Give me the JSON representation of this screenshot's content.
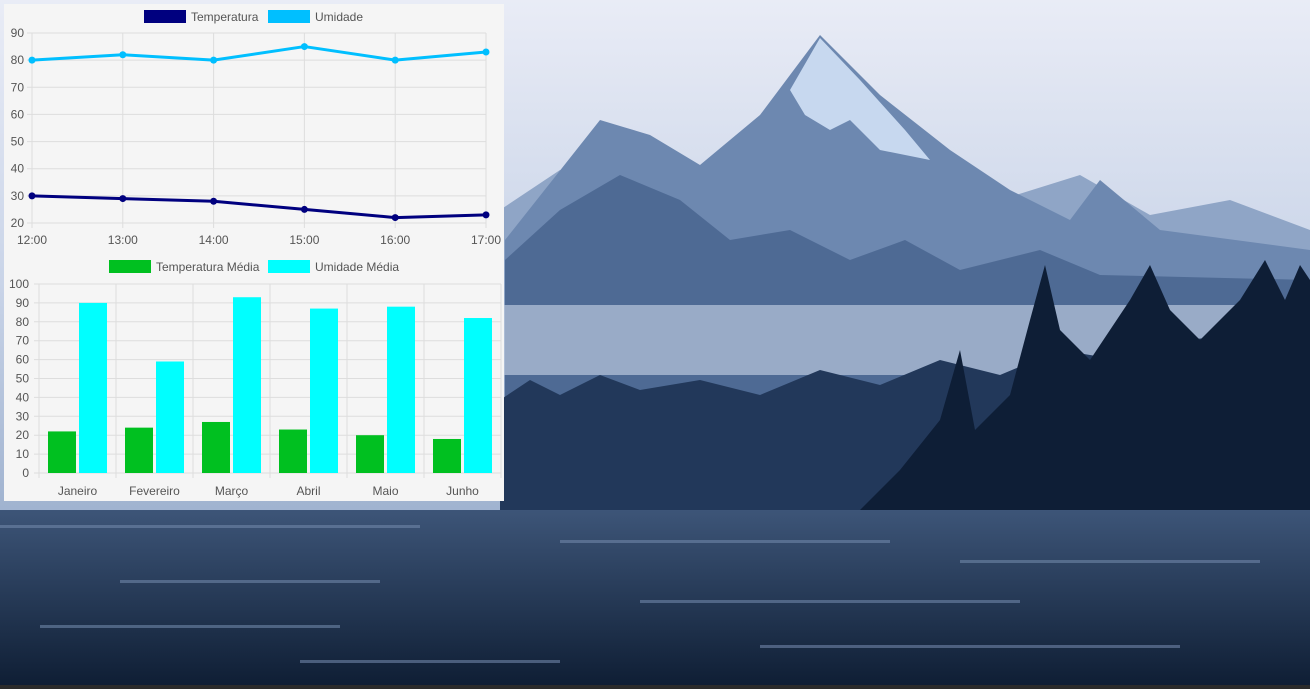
{
  "colors": {
    "temperatura": "#00007f",
    "umidade": "#00bfff",
    "temperatura_media": "#00c020",
    "umidade_media": "#00ffff",
    "panel_background": "#f5f5f5",
    "grid": "#dddddd"
  },
  "chart_data": [
    {
      "type": "line",
      "title": "",
      "legend_position": "top",
      "x": [
        "12:00",
        "13:00",
        "14:00",
        "15:00",
        "16:00",
        "17:00"
      ],
      "ylim": [
        20,
        90
      ],
      "yticks": [
        20,
        30,
        40,
        50,
        60,
        70,
        80,
        90
      ],
      "grid": true,
      "series": [
        {
          "name": "Temperatura",
          "color": "#00007f",
          "values": [
            30,
            29,
            28,
            25,
            22,
            23
          ]
        },
        {
          "name": "Umidade",
          "color": "#00bfff",
          "values": [
            80,
            82,
            80,
            85,
            80,
            83
          ]
        }
      ]
    },
    {
      "type": "bar",
      "title": "",
      "legend_position": "top",
      "categories": [
        "Janeiro",
        "Fevereiro",
        "Março",
        "Abril",
        "Maio",
        "Junho"
      ],
      "ylim": [
        0,
        100
      ],
      "yticks": [
        0,
        10,
        20,
        30,
        40,
        50,
        60,
        70,
        80,
        90,
        100
      ],
      "grid": true,
      "series": [
        {
          "name": "Temperatura Média",
          "color": "#00c020",
          "values": [
            22,
            24,
            27,
            23,
            20,
            18
          ]
        },
        {
          "name": "Umidade Média",
          "color": "#00ffff",
          "values": [
            90,
            59,
            93,
            87,
            88,
            82
          ]
        }
      ]
    }
  ]
}
